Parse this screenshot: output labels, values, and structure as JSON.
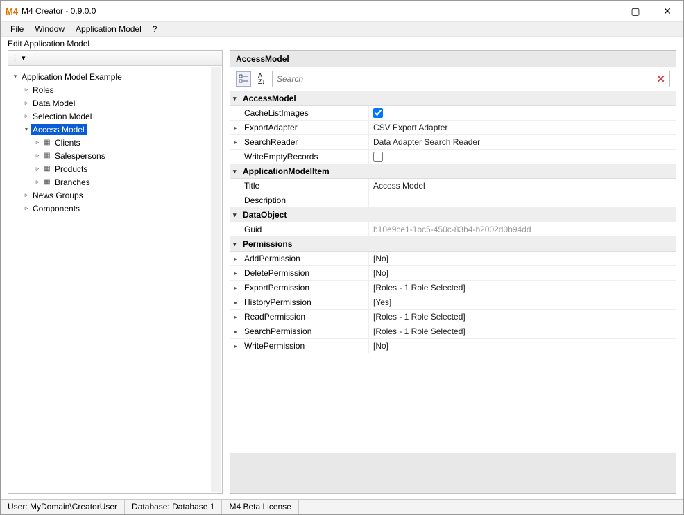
{
  "window": {
    "title": "M4 Creator - 0.9.0.0",
    "minimize_glyph": "—",
    "maximize_glyph": "▢",
    "close_glyph": "✕"
  },
  "menu": {
    "file": "File",
    "window": "Window",
    "app_model": "Application Model",
    "help": "?"
  },
  "view": {
    "title": "Edit Application Model"
  },
  "toolbar": {
    "dots": "⋮",
    "dropdown_glyph": "▾"
  },
  "tree": {
    "root": "Application Model Example",
    "roles": "Roles",
    "data_model": "Data Model",
    "selection_model": "Selection Model",
    "access_model": "Access Model",
    "clients": "Clients",
    "salespersons": "Salespersons",
    "products": "Products",
    "branches": "Branches",
    "news_groups": "News Groups",
    "components": "Components"
  },
  "props": {
    "header": "AccessModel",
    "search_placeholder": "Search",
    "az_glyph": "A↓Z",
    "clear_glyph": "✕",
    "cat_access_model": "AccessModel",
    "cache_list_images": "CacheListImages",
    "export_adapter": "ExportAdapter",
    "export_adapter_val": "CSV Export Adapter",
    "search_reader": "SearchReader",
    "search_reader_val": "Data Adapter Search Reader",
    "write_empty_records": "WriteEmptyRecords",
    "cat_app_model_item": "ApplicationModelItem",
    "title_key": "Title",
    "title_val": "Access Model",
    "description": "Description",
    "cat_data_object": "DataObject",
    "guid": "Guid",
    "guid_val": "b10e9ce1-1bc5-450c-83b4-b2002d0b94dd",
    "cat_permissions": "Permissions",
    "add_permission": "AddPermission",
    "delete_permission": "DeletePermission",
    "export_permission": "ExportPermission",
    "history_permission": "HistoryPermission",
    "read_permission": "ReadPermission",
    "search_permission": "SearchPermission",
    "write_permission": "WritePermission",
    "val_no": "[No]",
    "val_yes": "[Yes]",
    "val_roles1": "[Roles - 1 Role Selected]"
  },
  "status": {
    "user": "User: MyDomain\\CreatorUser",
    "database": "Database: Database 1",
    "license": "M4 Beta License"
  }
}
